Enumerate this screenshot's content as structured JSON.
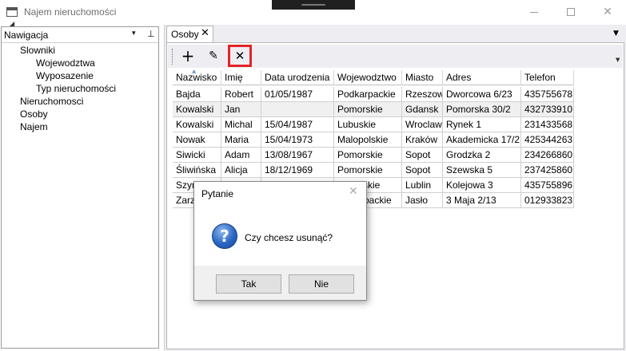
{
  "window": {
    "title": "Najem nieruchomości",
    "close_glyph": "✕"
  },
  "navigation": {
    "title": "Nawigacja",
    "dropdown_glyph": "▾",
    "pin_glyph": "⊥",
    "expand_glyph": "◢",
    "tree": [
      {
        "label": "Slowniki",
        "level": 1
      },
      {
        "label": "Wojewodztwa",
        "level": 2
      },
      {
        "label": "Wyposazenie",
        "level": 2
      },
      {
        "label": "Typ nieruchomości",
        "level": 2
      },
      {
        "label": "Nieruchomosci",
        "level": 1
      },
      {
        "label": "Osoby",
        "level": 1
      },
      {
        "label": "Najem",
        "level": 1
      }
    ]
  },
  "tabs": [
    {
      "label": "Osoby",
      "close_glyph": "✕",
      "active": true
    }
  ],
  "tab_menu_glyph": "▼",
  "toolbar": {
    "add_glyph": "+",
    "edit_glyph": "✎",
    "delete_glyph": "✕",
    "overflow_glyph": "▼",
    "highlight_color": "#e32328"
  },
  "grid": {
    "sort_glyph": "▲",
    "columns": [
      "Nazwisko",
      "Imię",
      "Data urodzenia",
      "Wojewodztwo",
      "Miasto",
      "Adres",
      "Telefon"
    ],
    "rows": [
      [
        "Bajda",
        "Robert",
        "01/05/1987",
        "Podkarpackie",
        "Rzeszow",
        "Dworcowa 6/23",
        "435755678"
      ],
      [
        "Kowalski",
        "Jan",
        "",
        "Pomorskie",
        "Gdansk",
        "Pomorska 30/2",
        "432733910"
      ],
      [
        "Kowalski",
        "Michal",
        "15/04/1987",
        "Lubuskie",
        "Wroclaw",
        "Rynek 1",
        "231433568"
      ],
      [
        "Nowak",
        "Maria",
        "15/04/1973",
        "Malopolskie",
        "Kraków",
        "Akademicka 17/2",
        "425344263"
      ],
      [
        "Siwicki",
        "Adam",
        "13/08/1967",
        "Pomorskie",
        "Sopot",
        "Grodzka 2",
        "234266860"
      ],
      [
        "Śliwińska",
        "Alicja",
        "18/12/1969",
        "Pomorskie",
        "Sopot",
        "Szewska 5",
        "237425860"
      ],
      [
        "Szym",
        "",
        "",
        "skie",
        "Lublin",
        "Kolejowa 3",
        "435755896"
      ],
      [
        "Zarz",
        "",
        "",
        "packie",
        "Jasło",
        "3 Maja 2/13",
        "012933823"
      ]
    ]
  },
  "dialog": {
    "title": "Pytanie",
    "close_glyph": "✕",
    "icon_glyph": "?",
    "message": "Czy chcesz usunąć?",
    "yes_label": "Tak",
    "no_label": "Nie"
  }
}
